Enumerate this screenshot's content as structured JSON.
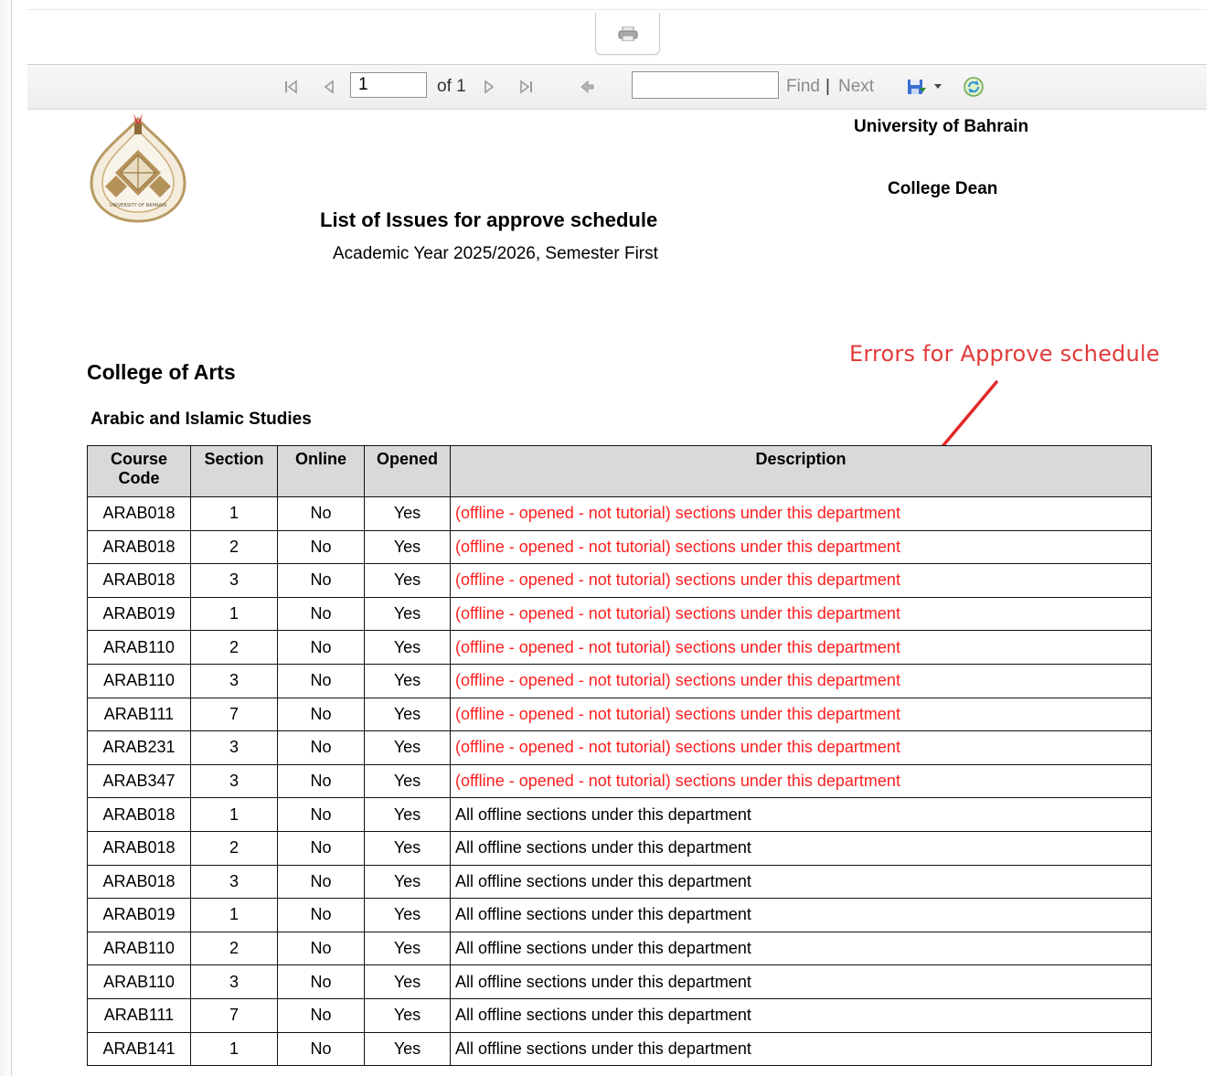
{
  "toolbar": {
    "page_value": "1",
    "of_label": "of 1",
    "find_label": "Find",
    "separator": "|",
    "next_label": "Next"
  },
  "header": {
    "university": "University of Bahrain",
    "dean": "College Dean",
    "title": "List of Issues for approve schedule",
    "subtitle": "Academic Year 2025/2026, Semester First",
    "logo_text": "UNIVERSITY OF BAHRAIN"
  },
  "annotation": "Errors for Approve schedule",
  "college": "College of Arts",
  "department": "Arabic and Islamic Studies",
  "table": {
    "headers": {
      "course_code_line1": "Course",
      "course_code_line2": "Code",
      "section": "Section",
      "online": "Online",
      "opened": "Opened",
      "description": "Description"
    },
    "rows": [
      {
        "code": "ARAB018",
        "section": "1",
        "online": "No",
        "opened": "Yes",
        "desc": "(offline - opened - not tutorial) sections under this department",
        "error": true
      },
      {
        "code": "ARAB018",
        "section": "2",
        "online": "No",
        "opened": "Yes",
        "desc": "(offline - opened - not tutorial) sections under this department",
        "error": true
      },
      {
        "code": "ARAB018",
        "section": "3",
        "online": "No",
        "opened": "Yes",
        "desc": "(offline - opened - not tutorial) sections under this department",
        "error": true
      },
      {
        "code": "ARAB019",
        "section": "1",
        "online": "No",
        "opened": "Yes",
        "desc": "(offline - opened - not tutorial) sections under this department",
        "error": true
      },
      {
        "code": "ARAB110",
        "section": "2",
        "online": "No",
        "opened": "Yes",
        "desc": "(offline - opened - not tutorial) sections under this department",
        "error": true
      },
      {
        "code": "ARAB110",
        "section": "3",
        "online": "No",
        "opened": "Yes",
        "desc": "(offline - opened - not tutorial) sections under this department",
        "error": true
      },
      {
        "code": "ARAB111",
        "section": "7",
        "online": "No",
        "opened": "Yes",
        "desc": "(offline - opened - not tutorial) sections under this department",
        "error": true
      },
      {
        "code": "ARAB231",
        "section": "3",
        "online": "No",
        "opened": "Yes",
        "desc": "(offline - opened - not tutorial) sections under this department",
        "error": true
      },
      {
        "code": "ARAB347",
        "section": "3",
        "online": "No",
        "opened": "Yes",
        "desc": "(offline - opened - not tutorial) sections under this department",
        "error": true
      },
      {
        "code": "ARAB018",
        "section": "1",
        "online": "No",
        "opened": "Yes",
        "desc": "All offline sections under this department",
        "error": false
      },
      {
        "code": "ARAB018",
        "section": "2",
        "online": "No",
        "opened": "Yes",
        "desc": "All offline sections under this department",
        "error": false
      },
      {
        "code": "ARAB018",
        "section": "3",
        "online": "No",
        "opened": "Yes",
        "desc": "All offline sections under this department",
        "error": false
      },
      {
        "code": "ARAB019",
        "section": "1",
        "online": "No",
        "opened": "Yes",
        "desc": "All offline sections under this department",
        "error": false
      },
      {
        "code": "ARAB110",
        "section": "2",
        "online": "No",
        "opened": "Yes",
        "desc": "All offline sections under this department",
        "error": false
      },
      {
        "code": "ARAB110",
        "section": "3",
        "online": "No",
        "opened": "Yes",
        "desc": "All offline sections under this department",
        "error": false
      },
      {
        "code": "ARAB111",
        "section": "7",
        "online": "No",
        "opened": "Yes",
        "desc": "All offline sections under this department",
        "error": false
      },
      {
        "code": "ARAB141",
        "section": "1",
        "online": "No",
        "opened": "Yes",
        "desc": "All offline sections under this department",
        "error": false
      }
    ]
  },
  "colors": {
    "error_text": "#ff1f1f",
    "annotation": "#e23a3a",
    "header_fill": "#d9d9d9"
  },
  "icons": [
    "printer-icon",
    "first-page-icon",
    "previous-page-icon",
    "next-page-icon",
    "last-page-icon",
    "back-icon",
    "export-save-icon",
    "dropdown-caret-icon",
    "refresh-icon",
    "university-seal-icon",
    "annotation-arrow-icon"
  ]
}
